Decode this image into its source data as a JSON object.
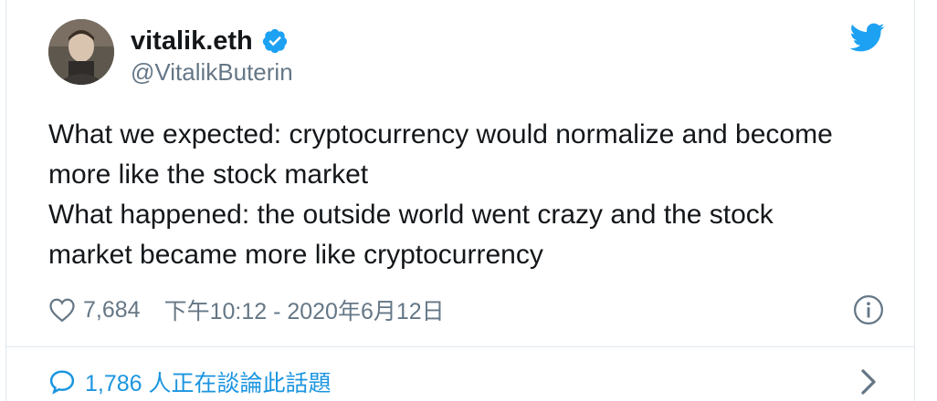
{
  "author": {
    "display_name": "vitalik.eth",
    "handle": "@VitalikButerin",
    "verified": true
  },
  "tweet": {
    "lines": [
      "What we expected: cryptocurrency would normalize and become",
      "more like the stock market",
      "What happened: the outside world went crazy and the stock",
      "market became more like cryptocurrency"
    ]
  },
  "meta": {
    "like_count": "7,684",
    "timestamp": "下午10:12 - 2020年6月12日"
  },
  "footer": {
    "conversation_text": "1,786 人正在談論此話題"
  },
  "icons": {
    "heart": "heart-icon",
    "info": "info-icon",
    "bird": "twitter-bird-icon",
    "verified": "verified-badge-icon",
    "reply": "reply-bubble-icon",
    "chevron": "chevron-right-icon"
  },
  "colors": {
    "brand_blue": "#1da1f2",
    "link_blue": "#1b95e0",
    "secondary_text": "#657786",
    "primary_text": "#14171a",
    "border": "#e1e8ed"
  }
}
